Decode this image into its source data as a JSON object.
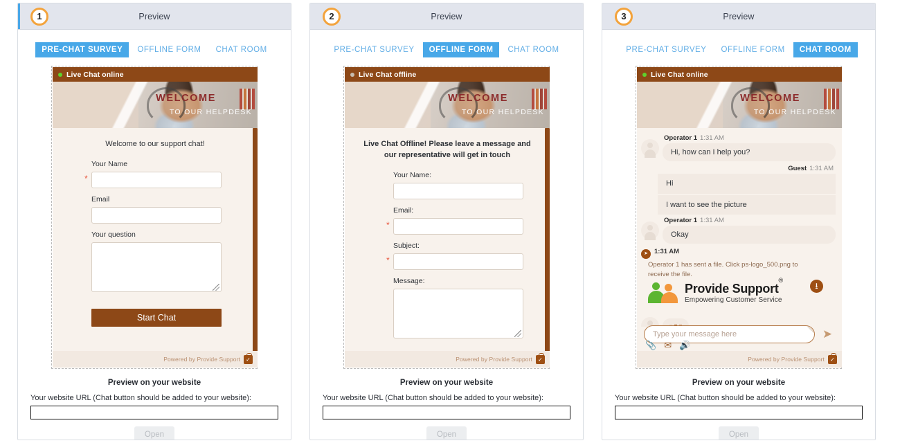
{
  "panels": [
    {
      "step": "1",
      "header_title": "Preview",
      "active_tab": "PRE-CHAT SURVEY",
      "tabs": [
        "PRE-CHAT SURVEY",
        "OFFLINE FORM",
        "CHAT ROOM"
      ],
      "widget": {
        "status_text": "Live Chat online",
        "status": "online",
        "banner_line1": "WELCOME",
        "banner_line2": "TO OUR HELPDESK",
        "intro": "Welcome to our support chat!",
        "fields": [
          {
            "label": "Your Name",
            "required": true,
            "type": "text"
          },
          {
            "label": "Email",
            "required": false,
            "type": "text"
          },
          {
            "label": "Your question",
            "required": false,
            "type": "textarea"
          }
        ],
        "submit_label": "Start Chat",
        "footer_text": "Powered by Provide Support"
      },
      "site": {
        "heading": "Preview on your website",
        "url_label": "Your website URL (Chat button should be added to your website):",
        "url_value": "",
        "url_placeholder": "",
        "open_label": "Open"
      }
    },
    {
      "step": "2",
      "header_title": "Preview",
      "active_tab": "OFFLINE FORM",
      "tabs": [
        "PRE-CHAT SURVEY",
        "OFFLINE FORM",
        "CHAT ROOM"
      ],
      "widget": {
        "status_text": "Live Chat offline",
        "status": "offline",
        "banner_line1": "WELCOME",
        "banner_line2": "TO OUR HELPDESK",
        "intro": "Live Chat Offline! Please leave a message and our representative will get in touch",
        "fields": [
          {
            "label": "Your Name:",
            "required": false,
            "type": "text"
          },
          {
            "label": "Email:",
            "required": true,
            "type": "text"
          },
          {
            "label": "Subject:",
            "required": true,
            "type": "text"
          },
          {
            "label": "Message:",
            "required": false,
            "type": "textarea"
          }
        ],
        "footer_text": "Powered by Provide Support"
      },
      "site": {
        "heading": "Preview on your website",
        "url_label": "Your website URL (Chat button should be added to your website):",
        "url_value": "",
        "url_placeholder": "",
        "open_label": "Open"
      }
    },
    {
      "step": "3",
      "header_title": "Preview",
      "active_tab": "CHAT ROOM",
      "tabs": [
        "PRE-CHAT SURVEY",
        "OFFLINE FORM",
        "CHAT ROOM"
      ],
      "widget": {
        "status_text": "Live Chat online",
        "status": "online",
        "banner_line1": "WELCOME",
        "banner_line2": "TO OUR HELPDESK",
        "footer_text": "Powered by Provide Support"
      },
      "chat": {
        "messages": [
          {
            "side": "operator",
            "author": "Operator 1",
            "time": "1:31 AM",
            "lines": [
              "Hi, how can I help you?"
            ]
          },
          {
            "side": "guest",
            "author": "Guest",
            "time": "1:31 AM",
            "lines": [
              "Hi",
              "I want to see the picture"
            ]
          },
          {
            "side": "operator",
            "author": "Operator 1",
            "time": "1:31 AM",
            "lines": [
              "Okay"
            ]
          }
        ],
        "file_transfer": {
          "time": "1:31 AM",
          "text": "Operator 1 has sent a file. Click ps-logo_500.png to receive the file.",
          "logo_title": "Provide Support",
          "logo_registered": "®",
          "logo_tagline": "Empowering Customer Service"
        },
        "composer_placeholder": "Type your message here",
        "composer_value": ""
      },
      "site": {
        "heading": "Preview on your website",
        "url_label": "Your website URL (Chat button should be added to your website):",
        "url_value": "",
        "url_placeholder": "",
        "open_label": "Open"
      }
    }
  ],
  "colors": {
    "tab_active_bg": "#48a8e8",
    "tab_text": "#62aee6",
    "widget_brown": "#8d4817",
    "widget_bg": "#f8f2ec",
    "bubble_bg": "#f2eae3",
    "badge_ring": "#f3a33c",
    "header_bg": "#e2e5ed",
    "accent_blue": "#4aa8e8",
    "status_online": "#5fd12c",
    "status_offline": "#c7bcae",
    "required_star": "#e8553c",
    "logo_green": "#5cb531",
    "logo_orange": "#f2973c"
  }
}
